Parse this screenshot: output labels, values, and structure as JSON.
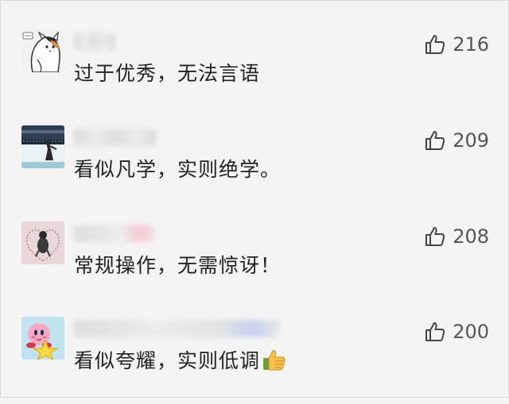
{
  "comments": [
    {
      "avatar": "cat-avatar",
      "text": "过于优秀，无法言语",
      "likes": "216"
    },
    {
      "avatar": "stadium-avatar",
      "text": "看似凡学，实则绝学。",
      "likes": "209"
    },
    {
      "avatar": "heart-girl-avatar",
      "text": "常规操作，无需惊讶！",
      "likes": "208"
    },
    {
      "avatar": "kirby-avatar",
      "text": "看似夸耀，实则低调",
      "emoji": "thumbs-up-emoji",
      "likes": "200"
    }
  ]
}
